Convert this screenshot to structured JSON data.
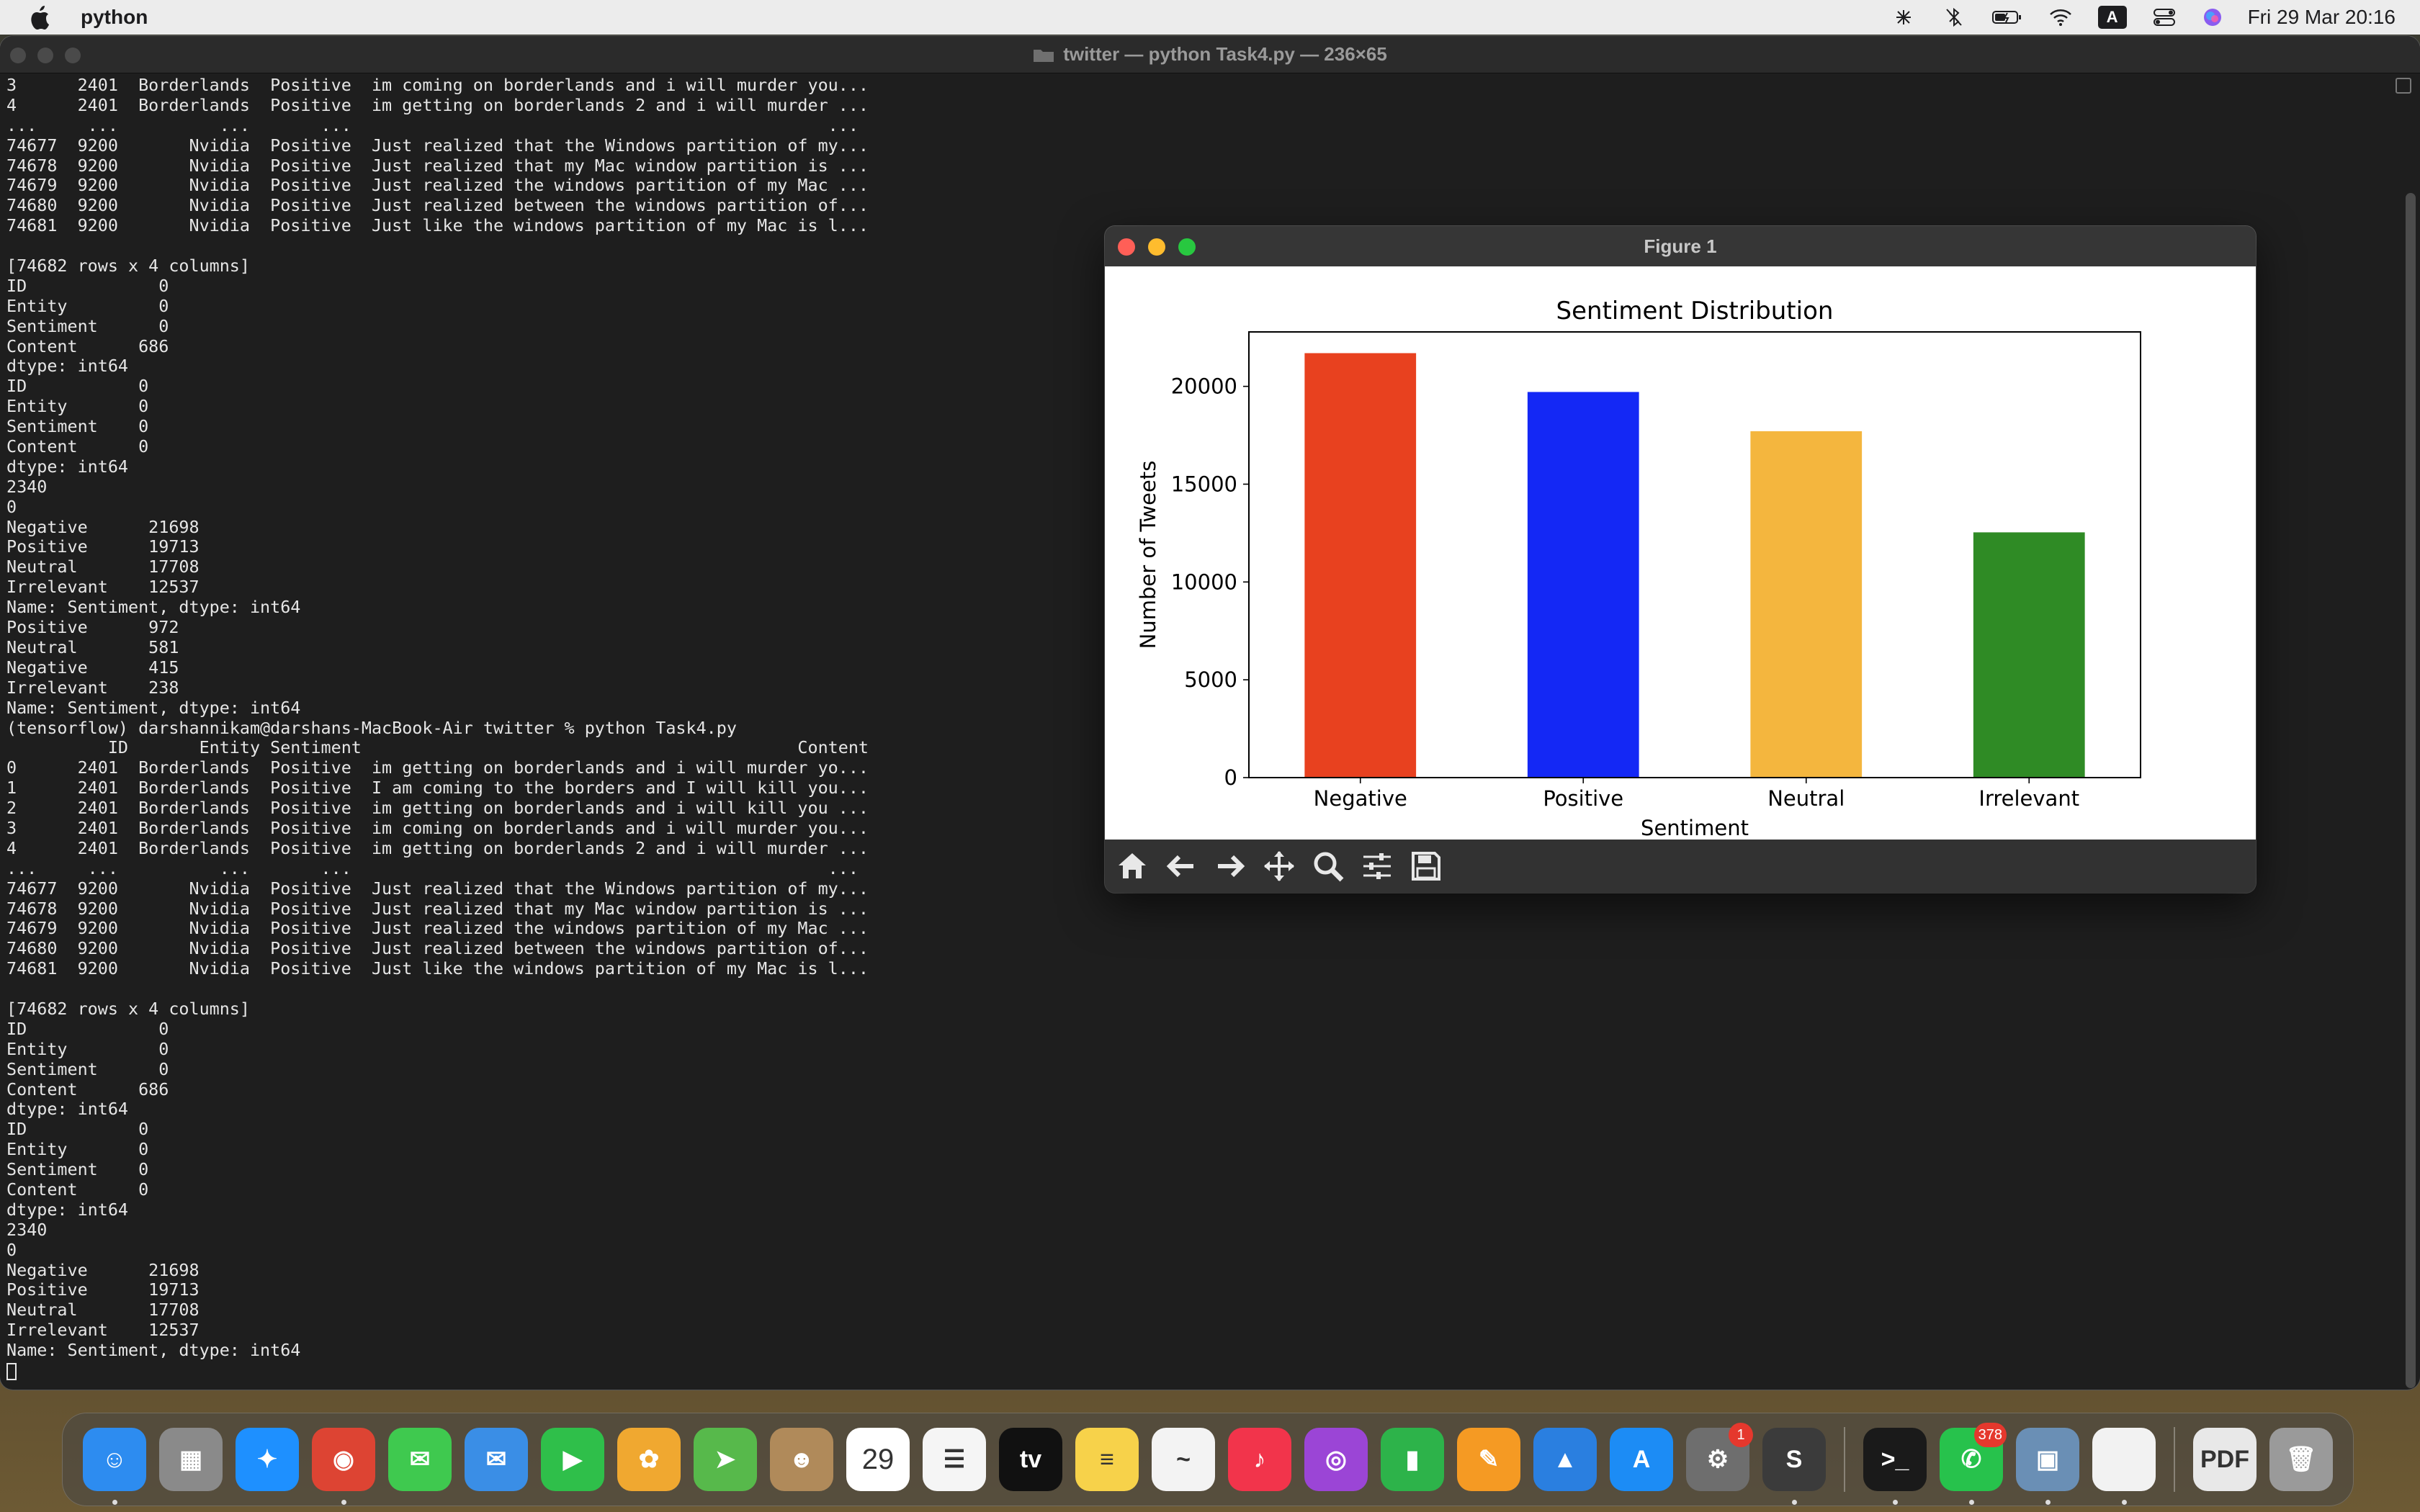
{
  "menubar": {
    "app_name": "python",
    "input_source": "A",
    "clock": "Fri 29 Mar  20:16"
  },
  "terminal": {
    "title": "twitter — python Task4.py — 236×65",
    "lines": [
      "3      2401  Borderlands  Positive  im coming on borderlands and i will murder you...",
      "4      2401  Borderlands  Positive  im getting on borderlands 2 and i will murder ...",
      "...     ...          ...       ...                                               ...",
      "74677  9200       Nvidia  Positive  Just realized that the Windows partition of my...",
      "74678  9200       Nvidia  Positive  Just realized that my Mac window partition is ...",
      "74679  9200       Nvidia  Positive  Just realized the windows partition of my Mac ...",
      "74680  9200       Nvidia  Positive  Just realized between the windows partition of...",
      "74681  9200       Nvidia  Positive  Just like the windows partition of my Mac is l...",
      "",
      "[74682 rows x 4 columns]",
      "ID             0",
      "Entity         0",
      "Sentiment      0",
      "Content      686",
      "dtype: int64",
      "ID           0",
      "Entity       0",
      "Sentiment    0",
      "Content      0",
      "dtype: int64",
      "2340",
      "0",
      "Negative      21698",
      "Positive      19713",
      "Neutral       17708",
      "Irrelevant    12537",
      "Name: Sentiment, dtype: int64",
      "Positive      972",
      "Neutral       581",
      "Negative      415",
      "Irrelevant    238",
      "Name: Sentiment, dtype: int64",
      "(tensorflow) darshannikam@darshans-MacBook-Air twitter % python Task4.py",
      "          ID       Entity Sentiment                                           Content",
      "0      2401  Borderlands  Positive  im getting on borderlands and i will murder yo...",
      "1      2401  Borderlands  Positive  I am coming to the borders and I will kill you...",
      "2      2401  Borderlands  Positive  im getting on borderlands and i will kill you ...",
      "3      2401  Borderlands  Positive  im coming on borderlands and i will murder you...",
      "4      2401  Borderlands  Positive  im getting on borderlands 2 and i will murder ...",
      "...     ...          ...       ...                                               ...",
      "74677  9200       Nvidia  Positive  Just realized that the Windows partition of my...",
      "74678  9200       Nvidia  Positive  Just realized that my Mac window partition is ...",
      "74679  9200       Nvidia  Positive  Just realized the windows partition of my Mac ...",
      "74680  9200       Nvidia  Positive  Just realized between the windows partition of...",
      "74681  9200       Nvidia  Positive  Just like the windows partition of my Mac is l...",
      "",
      "[74682 rows x 4 columns]",
      "ID             0",
      "Entity         0",
      "Sentiment      0",
      "Content      686",
      "dtype: int64",
      "ID           0",
      "Entity       0",
      "Sentiment    0",
      "Content      0",
      "dtype: int64",
      "2340",
      "0",
      "Negative      21698",
      "Positive      19713",
      "Neutral       17708",
      "Irrelevant    12537",
      "Name: Sentiment, dtype: int64"
    ]
  },
  "figure": {
    "title": "Figure 1",
    "toolbar": [
      {
        "name": "home-icon"
      },
      {
        "name": "back-arrow-icon"
      },
      {
        "name": "forward-arrow-icon"
      },
      {
        "name": "pan-icon"
      },
      {
        "name": "zoom-icon"
      },
      {
        "name": "configure-subplots-icon"
      },
      {
        "name": "save-icon"
      }
    ]
  },
  "chart_data": {
    "type": "bar",
    "title": "Sentiment Distribution",
    "xlabel": "Sentiment",
    "ylabel": "Number of Tweets",
    "categories": [
      "Negative",
      "Positive",
      "Neutral",
      "Irrelevant"
    ],
    "values": [
      21698,
      19713,
      17708,
      12537
    ],
    "colors": [
      "#e8411f",
      "#1428f5",
      "#f4b63e",
      "#2f8b25"
    ],
    "yticks": [
      "0",
      "5000",
      "10000",
      "15000",
      "20000"
    ],
    "ylim": [
      0,
      22783
    ],
    "grid": false,
    "legend": false
  },
  "dock": {
    "items": [
      {
        "name": "finder",
        "color": "#2d8cf0",
        "glyph": "☺",
        "running": true
      },
      {
        "name": "launchpad",
        "color": "#8a8a8a",
        "glyph": "▦",
        "running": false
      },
      {
        "name": "safari",
        "color": "#1e90ff",
        "glyph": "✦",
        "running": false
      },
      {
        "name": "chrome",
        "color": "#dd4433",
        "glyph": "◉",
        "running": true
      },
      {
        "name": "messages",
        "color": "#3fc94f",
        "glyph": "✉",
        "running": false
      },
      {
        "name": "mail",
        "color": "#3a8ee6",
        "glyph": "✉",
        "running": false
      },
      {
        "name": "facetime",
        "color": "#2fbf4a",
        "glyph": "▶",
        "running": false
      },
      {
        "name": "photos",
        "color": "#f0a830",
        "glyph": "✿",
        "running": false
      },
      {
        "name": "maps",
        "color": "#57b94b",
        "glyph": "➤",
        "running": false
      },
      {
        "name": "contacts",
        "color": "#b08a5a",
        "glyph": "☻",
        "running": false
      },
      {
        "name": "calendar",
        "color": "#ffffff",
        "glyph": "29",
        "running": false
      },
      {
        "name": "reminders",
        "color": "#f5f5f5",
        "glyph": "☰",
        "running": false
      },
      {
        "name": "apple-tv",
        "color": "#111111",
        "glyph": "tv",
        "running": false
      },
      {
        "name": "notes",
        "color": "#f7d24a",
        "glyph": "≡",
        "running": false
      },
      {
        "name": "freeform",
        "color": "#f3f3f3",
        "glyph": "~",
        "running": false
      },
      {
        "name": "music",
        "color": "#f2344b",
        "glyph": "♪",
        "running": false
      },
      {
        "name": "podcasts",
        "color": "#9b45d6",
        "glyph": "◎",
        "running": false
      },
      {
        "name": "numbers",
        "color": "#2db34a",
        "glyph": "▮",
        "running": false
      },
      {
        "name": "pages",
        "color": "#f59a23",
        "glyph": "✎",
        "running": false
      },
      {
        "name": "keynote",
        "color": "#2a7fe0",
        "glyph": "▲",
        "running": false
      },
      {
        "name": "app-store",
        "color": "#1c8cf5",
        "glyph": "A",
        "running": false
      },
      {
        "name": "system-settings",
        "color": "#6e6e6e",
        "glyph": "⚙",
        "running": false,
        "badge": "1"
      },
      {
        "name": "sublime-text",
        "color": "#3b3b3b",
        "glyph": "S",
        "running": true
      },
      {
        "name": "terminal",
        "color": "#1a1a1a",
        "glyph": ">_",
        "running": true
      },
      {
        "name": "whatsapp",
        "color": "#27c24c",
        "glyph": "✆",
        "running": true,
        "badge": "378"
      },
      {
        "name": "preview",
        "color": "#6a8fb5",
        "glyph": "▣",
        "running": true
      },
      {
        "name": "document",
        "color": "#f2f2f2",
        "glyph": "",
        "running": true
      },
      {
        "name": "pdf-stack",
        "color": "#e8e8e8",
        "glyph": "PDF",
        "running": false
      },
      {
        "name": "trash",
        "color": "#9a9a9a",
        "glyph": "🗑",
        "running": false
      }
    ]
  }
}
